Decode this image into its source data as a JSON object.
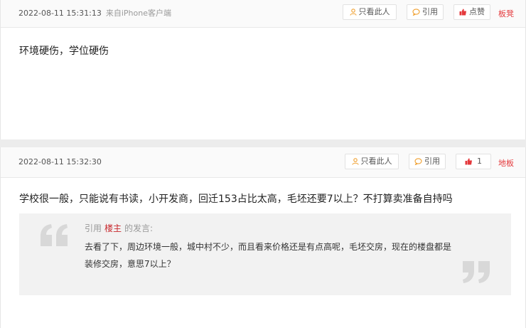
{
  "post1": {
    "time": "2022-08-11 15:31:13",
    "source": "来自iPhone客户端",
    "only_view_label": "只看此人",
    "quote_label": "引用",
    "like_label": "点赞",
    "floor": "板凳",
    "content": "环境硬伤，学位硬伤"
  },
  "post2": {
    "time": "2022-08-11 15:32:30",
    "only_view_label": "只看此人",
    "quote_label": "引用",
    "like_count": "1",
    "floor": "地板",
    "content": "学校很一般，只能说有书读，小开发商，回迁153占比太高，毛坯还要7以上？不打算卖准备自持吗",
    "quote": {
      "prefix": "引用",
      "author": "楼主",
      "suffix": "的发言:",
      "text": "去看了下，周边环境一般，城中村不少，而且看来价格还是有点高呢，毛坯交房，现在的楼盘都是装修交房，意思7以上？"
    }
  },
  "colors": {
    "accent_red": "#e4393c",
    "author_red": "#c8282d",
    "icon_orange": "#f0a030"
  }
}
